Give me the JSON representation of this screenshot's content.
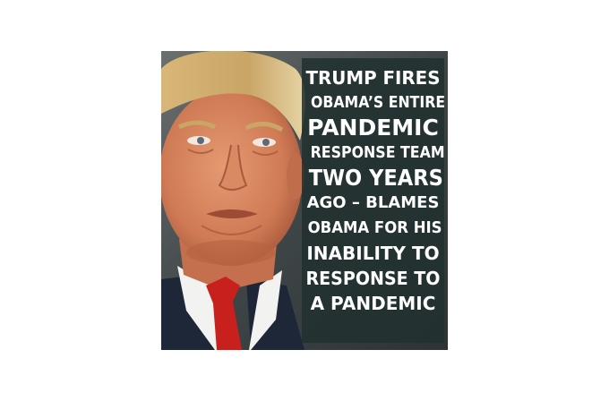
{
  "headline": {
    "lines": [
      "TRUMP FIRES",
      "OBAMA’S ENTIRE",
      "PANDEMIC",
      "RESPONSE TEAM",
      "TWO YEARS",
      "AGO – BLAMES",
      "OBAMA FOR HIS",
      "INABILITY TO",
      "RESPONSE TO",
      "A PANDEMIC"
    ]
  },
  "colors": {
    "caption_background": "#213130",
    "caption_text": "#ffffff",
    "tie": "#c8201c",
    "suit": "#1e2738"
  }
}
